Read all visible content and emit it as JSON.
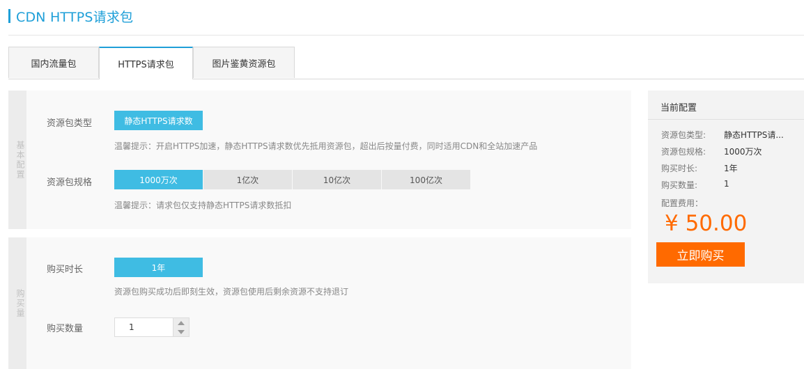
{
  "page": {
    "title": "CDN HTTPS请求包",
    "accent_color": "#1e9fd8"
  },
  "tabs": [
    {
      "label": "国内流量包",
      "active": false
    },
    {
      "label": "HTTPS请求包",
      "active": true
    },
    {
      "label": "图片鉴黄资源包",
      "active": false
    }
  ],
  "basic_section": {
    "side_label": "基本配置",
    "package_type": {
      "label": "资源包类型",
      "options": [
        "静态HTTPS请求数"
      ],
      "selected": "静态HTTPS请求数",
      "tip": "温馨提示：开启HTTPS加速，静态HTTPS请求数优先抵用资源包，超出后按量付费，同时适用CDN和全站加速产品"
    },
    "package_spec": {
      "label": "资源包规格",
      "options": [
        "1000万次",
        "1亿次",
        "10亿次",
        "100亿次"
      ],
      "selected": "1000万次",
      "tip": "温馨提示：请求包仅支持静态HTTPS请求数抵扣"
    }
  },
  "buy_section": {
    "side_label": "购买量",
    "duration": {
      "label": "购买时长",
      "options": [
        "1年"
      ],
      "selected": "1年",
      "tip": "资源包购买成功后即刻生效，资源包使用后剩余资源不支持退订"
    },
    "quantity": {
      "label": "购买数量",
      "value": "1"
    }
  },
  "summary": {
    "title": "当前配置",
    "rows": [
      {
        "label": "资源包类型:",
        "value": "静态HTTPS请..."
      },
      {
        "label": "资源包规格:",
        "value": "1000万次"
      },
      {
        "label": "购买时长:",
        "value": "1年"
      },
      {
        "label": "购买数量:",
        "value": "1"
      }
    ],
    "fee_label": "配置费用：",
    "price": "¥ 50.00",
    "buy_button": "立即购买",
    "price_color": "#ff6a00"
  },
  "colors": {
    "selected_option": "#3fbce3",
    "buy_button": "#ff6a00"
  }
}
